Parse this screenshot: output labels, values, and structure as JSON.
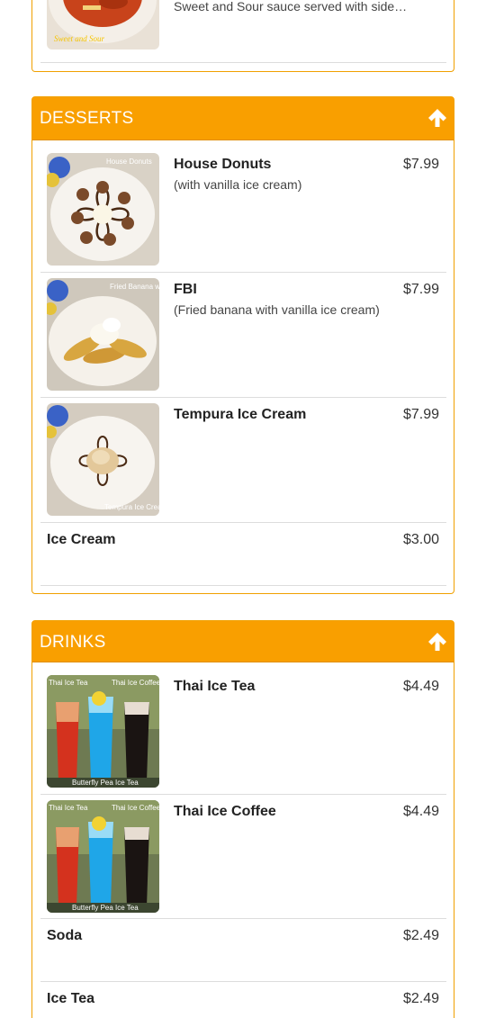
{
  "top_item": {
    "description": "Sweet and Sour sauce served with side…",
    "image_caption": "Sweet and Sour"
  },
  "sections": {
    "desserts": {
      "title": "DESSERTS",
      "items": [
        {
          "name": "House Donuts",
          "description": "(with vanilla ice cream)",
          "price": "$7.99",
          "image_caption": "House Donuts"
        },
        {
          "name": "FBI",
          "description": "(Fried banana with vanilla ice cream)",
          "price": "$7.99",
          "image_caption": "Fried Banana w/ Ice Cream"
        },
        {
          "name": "Tempura Ice Cream",
          "description": "",
          "price": "$7.99",
          "image_caption": "Tempura Ice Cream"
        },
        {
          "name": "Ice Cream",
          "description": "",
          "price": "$3.00"
        }
      ]
    },
    "drinks": {
      "title": "DRINKS",
      "items": [
        {
          "name": "Thai Ice Tea",
          "price": "$4.49",
          "image_caption_left": "Thai Ice Tea",
          "image_caption_right": "Thai Ice Coffee",
          "image_caption_bottom": "Butterfly Pea Ice Tea"
        },
        {
          "name": "Thai Ice Coffee",
          "price": "$4.49",
          "image_caption_left": "Thai Ice Tea",
          "image_caption_right": "Thai Ice Coffee",
          "image_caption_bottom": "Butterfly Pea Ice Tea"
        },
        {
          "name": "Soda",
          "price": "$2.49"
        },
        {
          "name": "Ice Tea",
          "price": "$2.49"
        }
      ]
    }
  },
  "icons": {
    "scroll_up": "arrow-up-icon"
  },
  "colors": {
    "header": "#f99f00",
    "panel_border": "#f0a000",
    "header_text": "#ffffff"
  }
}
